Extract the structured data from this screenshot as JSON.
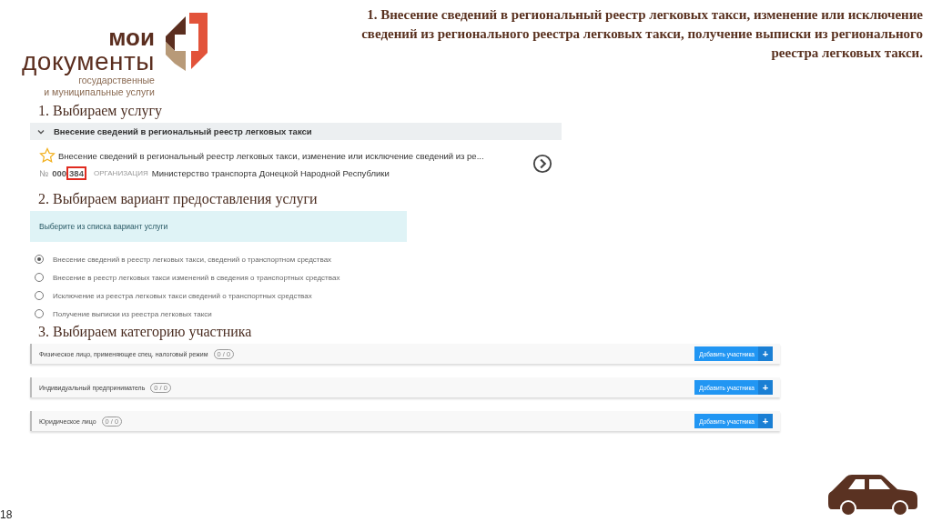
{
  "logo": {
    "line_1": "мои",
    "line_2": "документы",
    "line_3": "государственные",
    "line_4": "и муниципальные услуги"
  },
  "title": "1. Внесение сведений в региональный реестр легковых такси, изменение или исключение сведений из регионального реестра легковых такси, получение выписки из регионального реестра легковых такси.",
  "step_1": {
    "heading": "1. Выбираем услугу",
    "group": {
      "label": "Внесение сведений в региональный реестр легковых такси",
      "expanded": true
    },
    "service": {
      "name": "Внесение сведений в региональный реестр легковых такси, изменение или исключение сведений из ре...",
      "favorite": false,
      "number_label": "№",
      "number_prefix": "000",
      "number_highlight": "384",
      "org_label": "ОРГАНИЗАЦИЯ",
      "org": "Министерство транспорта Донецкой Народной Республики"
    }
  },
  "step_2": {
    "heading": "2. Выбираем вариант предоставления услуги",
    "info": "Выберите из списка вариант услуги",
    "options": [
      {
        "label": "Внесение сведений в реестр легковых такси, сведений о транспортном средствах",
        "selected": true
      },
      {
        "label": "Внесение в реестр легковых такси изменений в сведения о транспортных средствах",
        "selected": false
      },
      {
        "label": "Исключение из реестра легковых такси сведений о транспортных средствах",
        "selected": false
      },
      {
        "label": "Получение выписки из реестра легковых такси",
        "selected": false
      }
    ]
  },
  "step_3": {
    "heading": "3. Выбираем категорию участника",
    "categories": [
      {
        "label": "Физическое лицо, применяющее спец. налоговый режим",
        "count": "0 / 0",
        "button": "Добавить участника",
        "button_icon": "+"
      },
      {
        "label": "Индивидуальный предприниматель",
        "count": "0 / 0",
        "button": "Добавить участника",
        "button_icon": "+"
      },
      {
        "label": "Юридическое лицо",
        "count": "0 / 0",
        "button": "Добавить участника",
        "button_icon": "+"
      }
    ]
  },
  "page_number": "18"
}
